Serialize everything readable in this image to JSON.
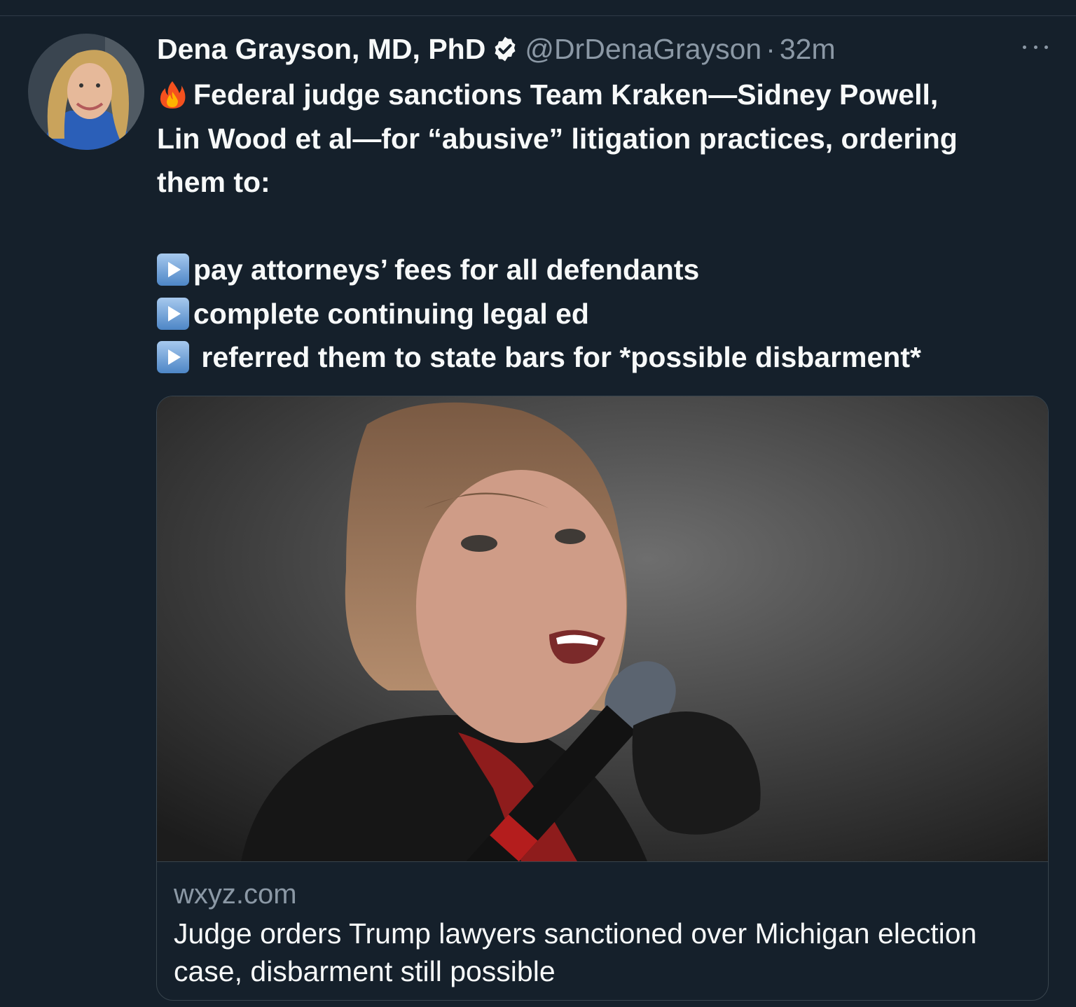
{
  "tweet": {
    "author": {
      "display_name": "Dena Grayson, MD, PhD",
      "handle": "@DrDenaGrayson",
      "verified": true,
      "avatar_icon": "profile-photo"
    },
    "separator": "·",
    "timestamp": "32m",
    "more_icon": "ellipsis-icon",
    "text": {
      "line1": "Federal judge sanctions Team Kraken—Sidney Powell,",
      "line2": "Lin Wood et al—for “abusive” litigation practices, ordering",
      "line3": "them to:",
      "bullet1": "pay attorneys’ fees for all defendants",
      "bullet2": "complete continuing legal ed",
      "bullet3": " referred them to state bars for *possible disbarment*"
    },
    "link_card": {
      "domain": "wxyz.com",
      "title": "Judge orders Trump lawyers sanctioned over Michigan election case, disbarment still possible"
    }
  },
  "colors": {
    "background": "#15202b",
    "text_primary": "#f7f9f9",
    "text_secondary": "#8b98a5",
    "border": "#38444d"
  }
}
